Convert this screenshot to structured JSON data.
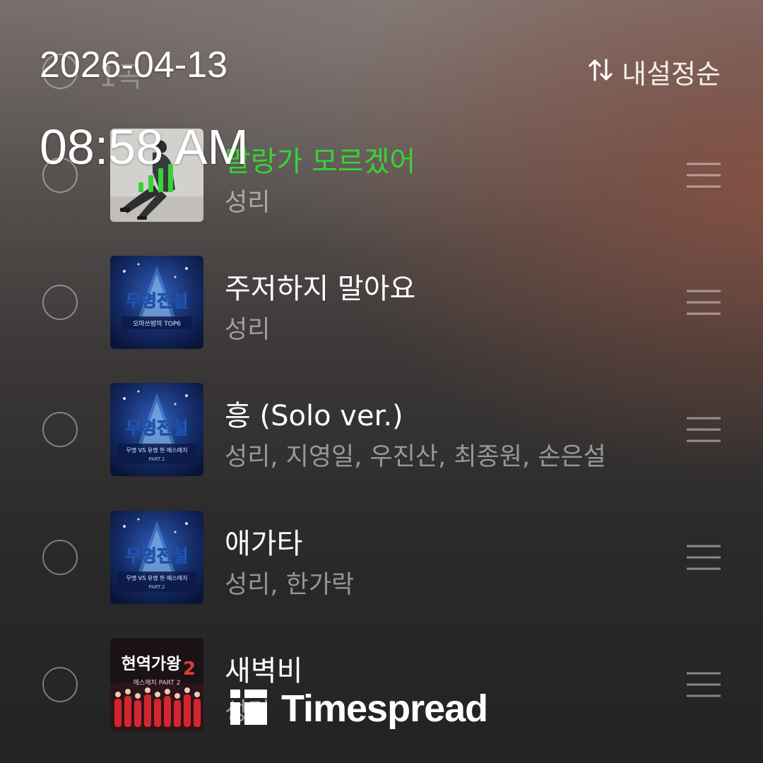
{
  "overlay": {
    "date": "2026-04-13",
    "time": "08:58 AM",
    "watermark": "Timespread"
  },
  "header": {
    "ghost_label": "1곡",
    "sort_icon": "sort-arrows-icon",
    "sort_label": "내설정순"
  },
  "colors": {
    "now_playing": "#37d237",
    "background_top": "#7a6f6c",
    "background_accent": "#96503e",
    "background_bottom": "#232323"
  },
  "songs": [
    {
      "title": "말랑가 모르겠어",
      "artist": "성리",
      "now_playing": true,
      "album_art": "singer-photo-art"
    },
    {
      "title": "주저하지 말아요",
      "artist": "성리",
      "now_playing": false,
      "album_art": "show-logo-art",
      "art_title": "무명전설",
      "art_subtitle": "오마쓰밤의 TOP6"
    },
    {
      "title": "흥 (Solo ver.)",
      "artist": "성리, 지영일, 우진산, 최종원, 손은설",
      "now_playing": false,
      "album_art": "show-logo-art",
      "art_title": "무명전설",
      "art_subtitle": "무명 VS 유명 한 메스매치",
      "art_part": "PART.1"
    },
    {
      "title": "애가타",
      "artist": "성리, 한가락",
      "now_playing": false,
      "album_art": "show-logo-art",
      "art_title": "무명전설",
      "art_subtitle": "무명 VS 유명 한 메스매치",
      "art_part": "PART.2"
    },
    {
      "title": "새벽비",
      "artist": "성리",
      "now_playing": false,
      "album_art": "show-logo-art-red",
      "art_title": "현역가왕",
      "art_number": "2",
      "art_subtitle": "메스매치 PART 2"
    }
  ]
}
